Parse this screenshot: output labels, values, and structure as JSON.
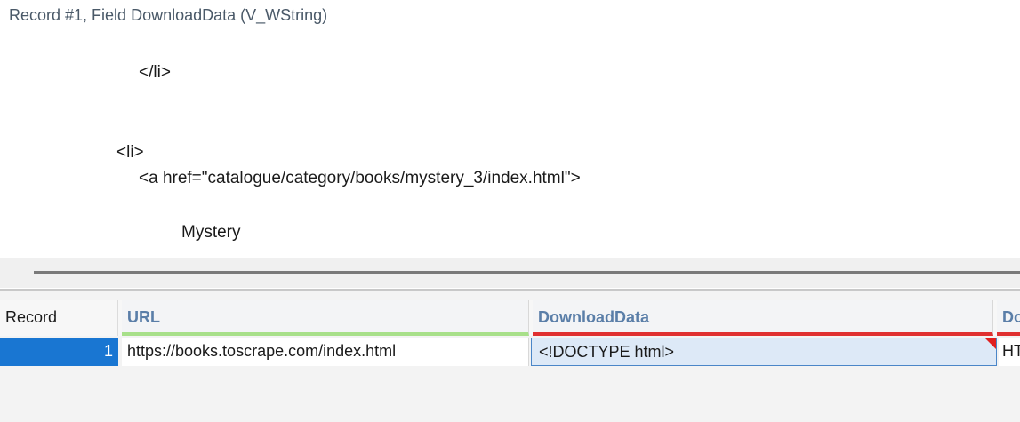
{
  "field_viewer": {
    "header": "Record #1, Field DownloadData (V_WString)",
    "lines": [
      "</li>",
      "<li>",
      "<a href=\"catalogue/category/books/mystery_3/index.html\">",
      "Mystery"
    ]
  },
  "grid": {
    "columns": [
      {
        "label": "Record"
      },
      {
        "label": "URL",
        "status_color": "#a8e08a"
      },
      {
        "label": "DownloadData",
        "status_color": "#e03030"
      },
      {
        "label": "Do",
        "status_color": "#e03030"
      }
    ],
    "rows": [
      {
        "record": "1",
        "url": "https://books.toscrape.com/index.html",
        "download_data": "<!DOCTYPE html>",
        "extra": "HT"
      }
    ]
  },
  "colors": {
    "selected_record": "#1976d2",
    "selected_cell": "#dde9f7",
    "header_text": "#5a7ea8"
  }
}
